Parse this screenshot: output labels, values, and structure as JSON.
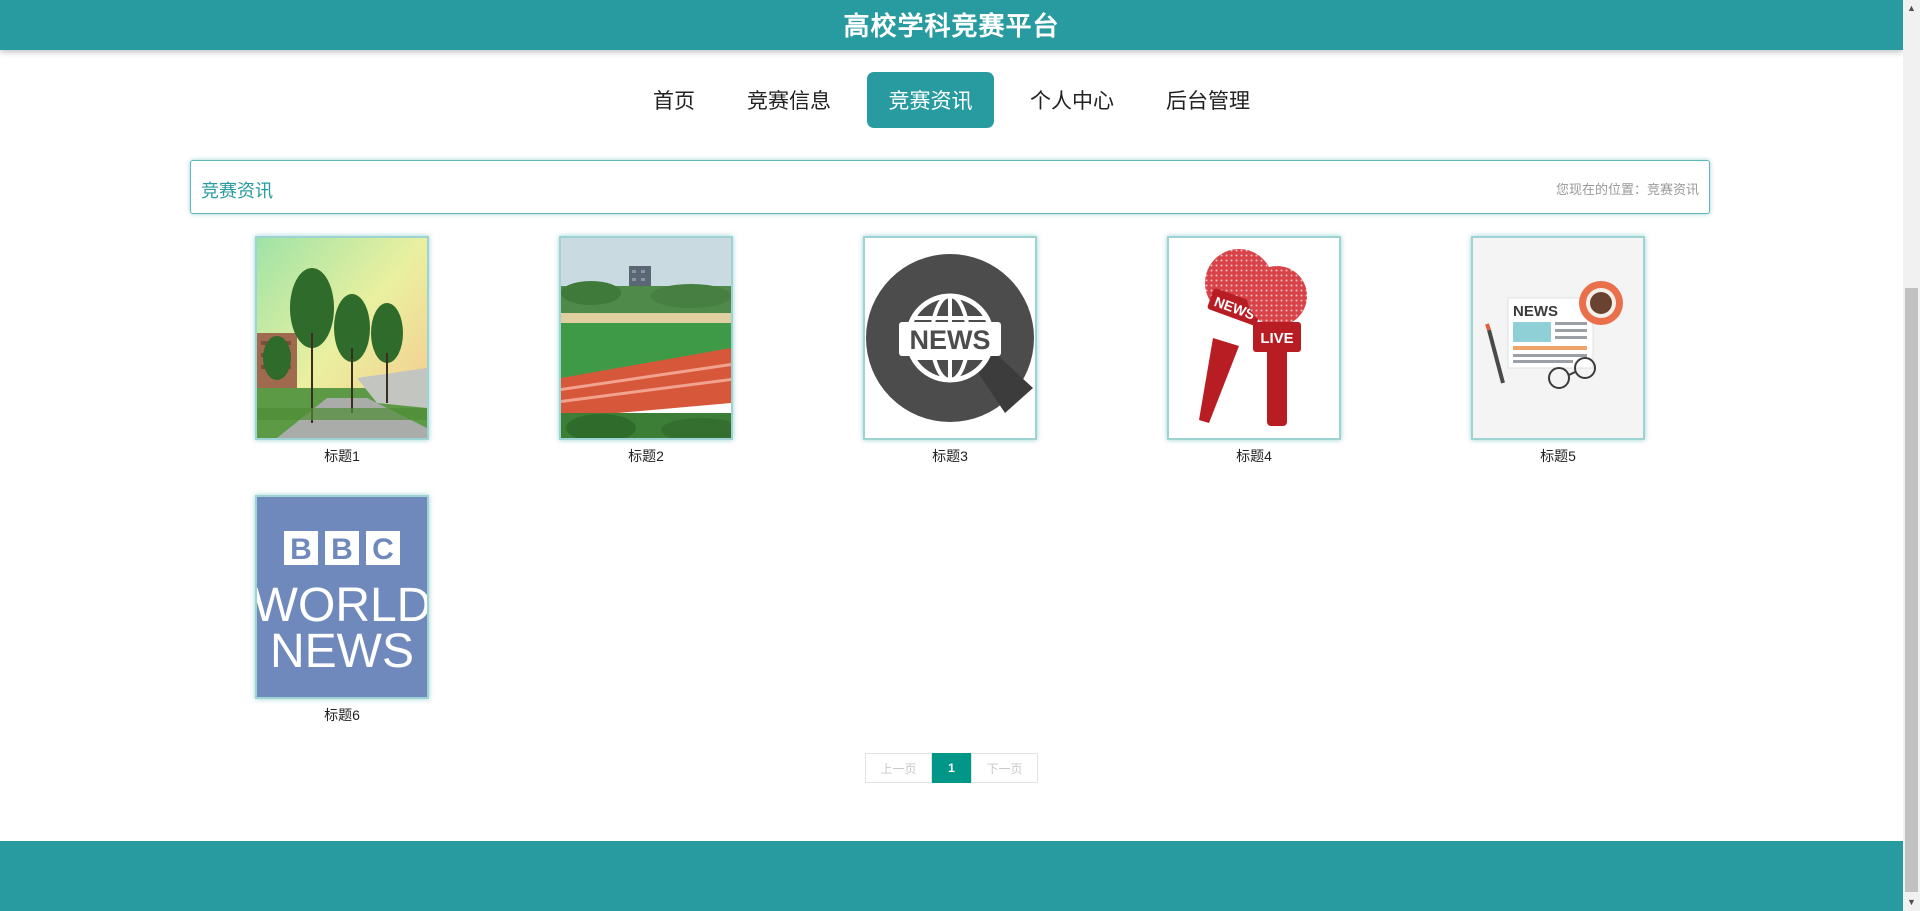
{
  "header": {
    "title": "高校学科竞赛平台"
  },
  "nav": {
    "items": [
      {
        "label": "首页",
        "active": false
      },
      {
        "label": "竞赛信息",
        "active": false
      },
      {
        "label": "竞赛资讯",
        "active": true
      },
      {
        "label": "个人中心",
        "active": false
      },
      {
        "label": "后台管理",
        "active": false
      }
    ]
  },
  "section": {
    "title": "竞赛资讯",
    "breadcrumb": "您现在的位置：竞赛资讯"
  },
  "news_items": [
    {
      "label": "标题1",
      "image": "campus-trees-photo"
    },
    {
      "label": "标题2",
      "image": "sports-field-photo"
    },
    {
      "label": "标题3",
      "image": "news-globe-icon"
    },
    {
      "label": "标题4",
      "image": "live-microphones-icon"
    },
    {
      "label": "标题5",
      "image": "newspaper-coffee-icon"
    },
    {
      "label": "标题6",
      "image": "bbc-world-news-logo"
    }
  ],
  "logos": {
    "news_badge": "NEWS",
    "mic_flag": "NEWS",
    "live_badge": "LIVE",
    "newspaper_heading": "NEWS",
    "bbc_letters": [
      "B",
      "B",
      "C"
    ],
    "bbc_line1": "WORLD",
    "bbc_line2": "NEWS"
  },
  "pagination": {
    "prev_label": "上一页",
    "current_page": "1",
    "next_label": "下一页"
  },
  "colors": {
    "primary": "#279b9f",
    "pagination_active": "#009688"
  }
}
